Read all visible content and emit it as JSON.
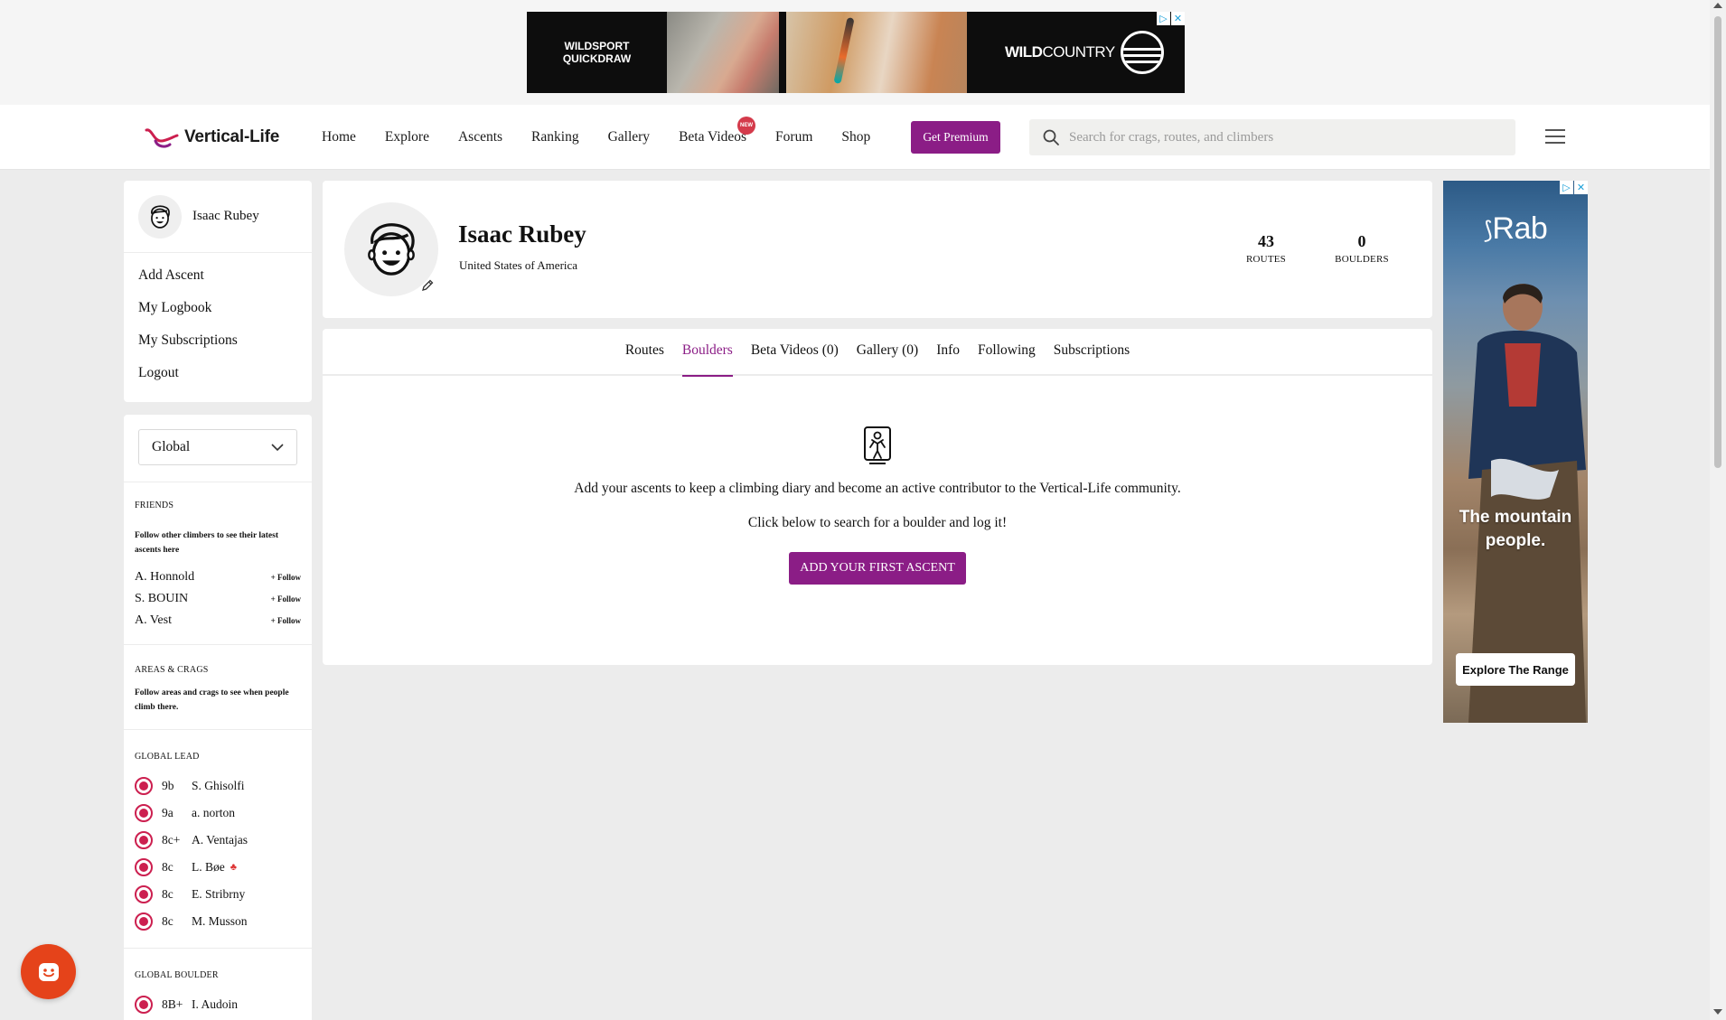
{
  "top_ad": {
    "brand_left": "WILDSPORT QUICKDRAW",
    "brand_right_bold": "WILD",
    "brand_right_light": "COUNTRY"
  },
  "nav": {
    "logo_text": "Vertical-Life",
    "links": [
      "Home",
      "Explore",
      "Ascents",
      "Ranking",
      "Gallery",
      "Beta Videos",
      "Forum",
      "Shop"
    ],
    "new_badge": "NEW",
    "premium_label": "Get Premium",
    "search_placeholder": "Search for crags, routes, and climbers"
  },
  "sidebar": {
    "user_name": "Isaac Rubey",
    "menu": [
      "Add Ascent",
      "My Logbook",
      "My Subscriptions",
      "Logout"
    ],
    "scope_select": "Global",
    "friends": {
      "title": "FRIENDS",
      "desc": "Follow other climbers to see their latest ascents here",
      "follow_label": "+ Follow",
      "items": [
        "A. Honnold",
        "S. BOUIN",
        "A. Vest"
      ]
    },
    "areas": {
      "title": "AREAS & CRAGS",
      "desc": "Follow areas and crags to see when people climb there."
    },
    "global_lead": {
      "title": "GLOBAL LEAD",
      "items": [
        {
          "grade": "9b",
          "name": "S. Ghisolfi"
        },
        {
          "grade": "9a",
          "name": "a. norton"
        },
        {
          "grade": "8c+",
          "name": "A. Ventajas"
        },
        {
          "grade": "8c",
          "name": "L. Bøe",
          "flag": "♣"
        },
        {
          "grade": "8c",
          "name": "E. Stribrny"
        },
        {
          "grade": "8c",
          "name": "M. Musson"
        }
      ]
    },
    "global_boulder": {
      "title": "GLOBAL BOULDER",
      "items": [
        {
          "grade": "8B+",
          "name": "I. Audoin"
        }
      ]
    }
  },
  "profile": {
    "name": "Isaac Rubey",
    "country": "United States of America",
    "stats": [
      {
        "value": "43",
        "label": "ROUTES"
      },
      {
        "value": "0",
        "label": "BOULDERS"
      }
    ]
  },
  "tabs": {
    "items": [
      "Routes",
      "Boulders",
      "Beta Videos (0)",
      "Gallery (0)",
      "Info",
      "Following",
      "Subscriptions"
    ],
    "active": "Boulders"
  },
  "empty_state": {
    "text1": "Add your ascents to keep a climbing diary and become an active contributor to the Vertical-Life community.",
    "text2": "Click below to search for a boulder and log it!",
    "button": "ADD YOUR FIRST ASCENT"
  },
  "side_ad": {
    "brand": "Rab",
    "tagline_1": "The mountain",
    "tagline_2": "people.",
    "cta": "Explore The Range"
  },
  "colors": {
    "accent": "#8b1d86",
    "rank_red": "#cc1f4f",
    "chat_orange": "#e5431a"
  }
}
